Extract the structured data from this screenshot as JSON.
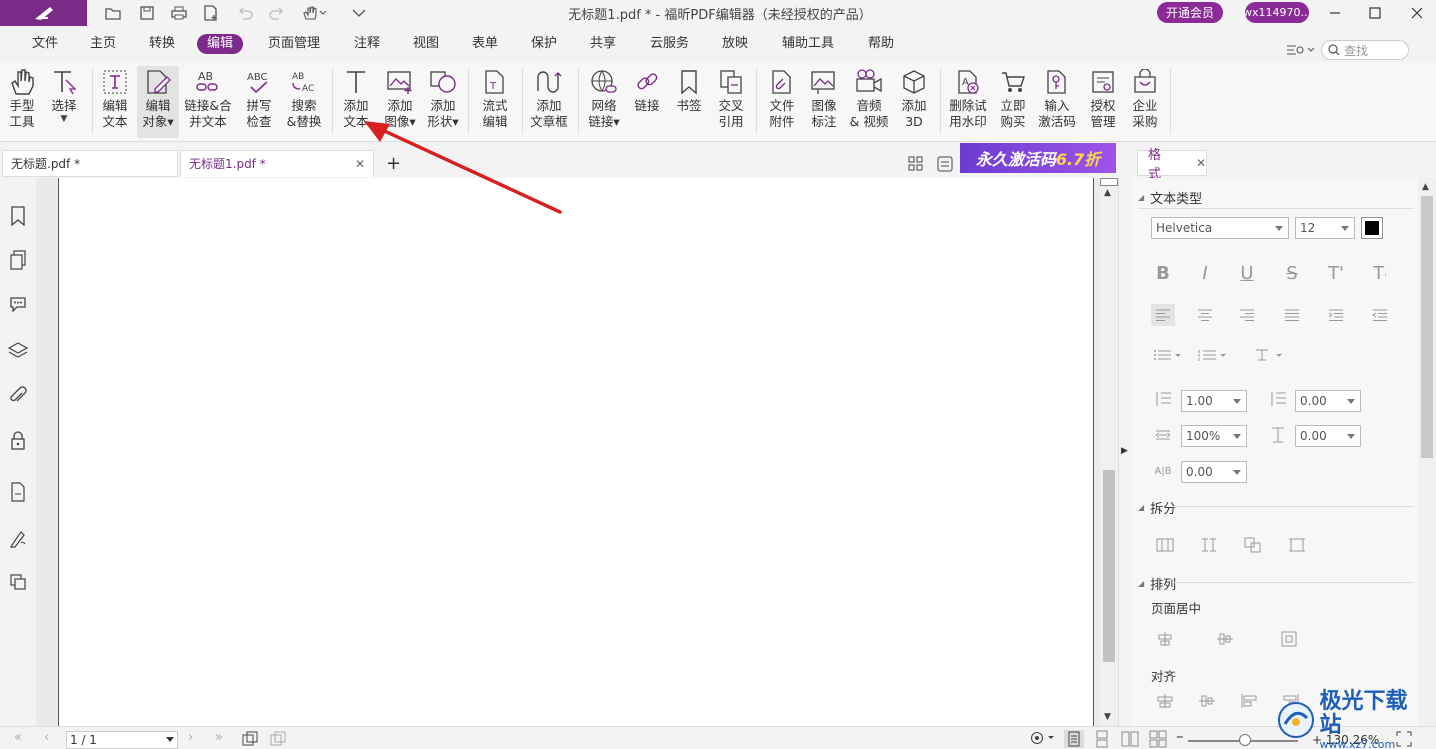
{
  "titlebar": {
    "doc_title": "无标题1.pdf * - 福昕PDF编辑器（未经授权的产品）",
    "vip_label": "开通会员",
    "user_label": "wx114970..."
  },
  "menu": {
    "items": [
      "文件",
      "主页",
      "转换",
      "编辑",
      "页面管理",
      "注释",
      "视图",
      "表单",
      "保护",
      "共享",
      "云服务",
      "放映",
      "辅助工具",
      "帮助"
    ],
    "active_index": 3,
    "search_placeholder": "查找"
  },
  "ribbon": {
    "tools": [
      {
        "label": "手型\n工具",
        "icon": "hand-icon"
      },
      {
        "label": "选择",
        "icon": "select-cursor-icon",
        "dropdown": true
      },
      {
        "label": "编辑\n文本",
        "icon": "edit-text-icon"
      },
      {
        "label": "编辑\n对象▾",
        "icon": "edit-object-icon",
        "selected": true
      },
      {
        "label": "链接&合\n并文本",
        "icon": "link-merge-text-icon"
      },
      {
        "label": "拼写\n检查",
        "icon": "spell-check-icon"
      },
      {
        "label": "搜索\n&替换",
        "icon": "search-replace-icon"
      },
      {
        "label": "添加\n文本",
        "icon": "add-text-icon"
      },
      {
        "label": "添加\n图像▾",
        "icon": "add-image-icon"
      },
      {
        "label": "添加\n形状▾",
        "icon": "add-shape-icon"
      },
      {
        "label": "流式\n编辑",
        "icon": "flow-edit-icon"
      },
      {
        "label": "添加\n文章框",
        "icon": "add-article-box-icon"
      },
      {
        "label": "网络\n链接▾",
        "icon": "web-link-icon"
      },
      {
        "label": "链接",
        "icon": "link-icon"
      },
      {
        "label": "书签",
        "icon": "bookmark-icon"
      },
      {
        "label": "交叉\n引用",
        "icon": "cross-reference-icon"
      },
      {
        "label": "文件\n附件",
        "icon": "file-attachment-icon"
      },
      {
        "label": "图像\n标注",
        "icon": "image-annotation-icon"
      },
      {
        "label": "音频\n& 视频",
        "icon": "audio-video-icon"
      },
      {
        "label": "添加\n3D",
        "icon": "add-3d-icon"
      },
      {
        "label": "删除试\n用水印",
        "icon": "remove-watermark-icon"
      },
      {
        "label": "立即\n购买",
        "icon": "cart-icon"
      },
      {
        "label": "输入\n激活码",
        "icon": "activation-key-icon"
      },
      {
        "label": "授权\n管理",
        "icon": "license-manage-icon"
      },
      {
        "label": "企业\n采购",
        "icon": "enterprise-purchase-icon"
      }
    ]
  },
  "doc_tabs": [
    {
      "label": "无标题.pdf *",
      "active": false
    },
    {
      "label": "无标题1.pdf *",
      "active": true
    }
  ],
  "promo": {
    "text": "永久激活码",
    "highlight": "6.7折"
  },
  "format_panel": {
    "tab_label": "格式",
    "text_type_title": "文本类型",
    "font_name": "Helvetica",
    "font_size": "12",
    "line_spacing": "1.00",
    "para_spacing": "0.00",
    "char_scale": "100%",
    "char_spacing": "0.00",
    "baseline": "0.00",
    "split_title": "拆分",
    "arrange_title": "排列",
    "page_center_label": "页面居中",
    "align_label": "对齐"
  },
  "status": {
    "page_value": "1 / 1",
    "zoom": "+ 130.26%"
  },
  "watermark": {
    "main": "极光下载站",
    "sub": "www.xz7.com"
  }
}
